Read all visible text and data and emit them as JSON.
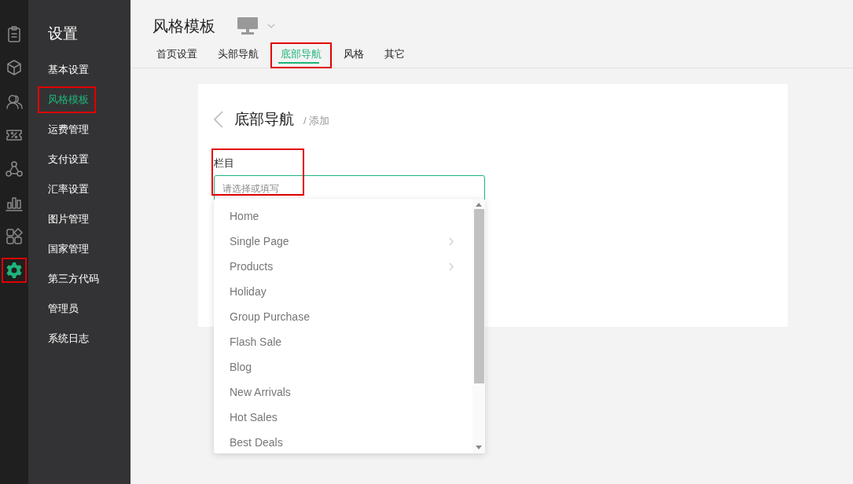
{
  "rail": [
    {
      "selected": false,
      "highlighted": false
    },
    {
      "selected": false,
      "highlighted": false
    },
    {
      "selected": false,
      "highlighted": false
    },
    {
      "selected": false,
      "highlighted": false
    },
    {
      "selected": false,
      "highlighted": false
    },
    {
      "selected": false,
      "highlighted": false
    },
    {
      "selected": false,
      "highlighted": false
    },
    {
      "selected": true,
      "highlighted": true
    }
  ],
  "sidebar": {
    "title": "设置",
    "items": [
      {
        "label": "基本设置",
        "selected": false,
        "highlighted": false
      },
      {
        "label": "风格模板",
        "selected": true,
        "highlighted": true
      },
      {
        "label": "运费管理",
        "selected": false,
        "highlighted": false
      },
      {
        "label": "支付设置",
        "selected": false,
        "highlighted": false
      },
      {
        "label": "汇率设置",
        "selected": false,
        "highlighted": false
      },
      {
        "label": "图片管理",
        "selected": false,
        "highlighted": false
      },
      {
        "label": "国家管理",
        "selected": false,
        "highlighted": false
      },
      {
        "label": "第三方代码",
        "selected": false,
        "highlighted": false
      },
      {
        "label": "管理员",
        "selected": false,
        "highlighted": false
      },
      {
        "label": "系统日志",
        "selected": false,
        "highlighted": false
      }
    ]
  },
  "header": {
    "title": "风格模板",
    "tabs": [
      {
        "label": "首页设置",
        "selected": false,
        "highlighted": false
      },
      {
        "label": "头部导航",
        "selected": false,
        "highlighted": false
      },
      {
        "label": "底部导航",
        "selected": true,
        "highlighted": true
      },
      {
        "label": "风格",
        "selected": false,
        "highlighted": false
      },
      {
        "label": "其它",
        "selected": false,
        "highlighted": false
      }
    ]
  },
  "card": {
    "title": "底部导航",
    "crumb": "/ 添加",
    "field": {
      "label": "栏目",
      "placeholder": "请选择或填写",
      "highlighted": true
    },
    "dropdown": [
      {
        "label": "Home",
        "has_submenu": false
      },
      {
        "label": "Single Page",
        "has_submenu": true
      },
      {
        "label": "Products",
        "has_submenu": true
      },
      {
        "label": "Holiday",
        "has_submenu": false
      },
      {
        "label": "Group Purchase",
        "has_submenu": false
      },
      {
        "label": "Flash Sale",
        "has_submenu": false
      },
      {
        "label": "Blog",
        "has_submenu": false
      },
      {
        "label": "New Arrivals",
        "has_submenu": false
      },
      {
        "label": "Hot Sales",
        "has_submenu": false
      },
      {
        "label": "Best Deals",
        "has_submenu": false
      }
    ]
  }
}
